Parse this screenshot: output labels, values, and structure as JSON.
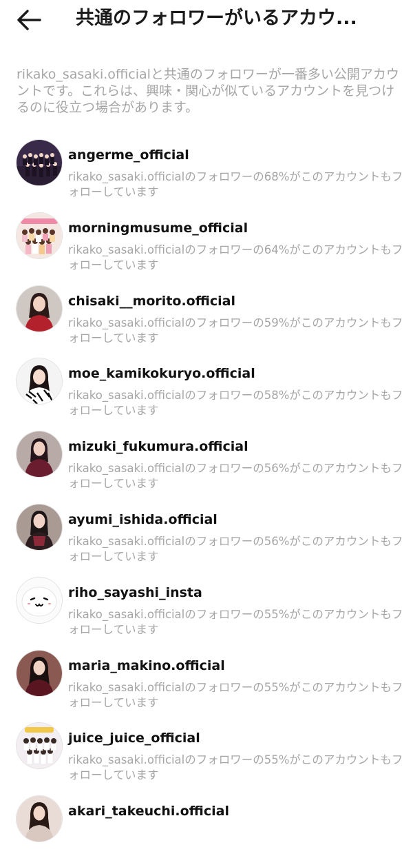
{
  "header": {
    "back_icon": "arrow-left-icon",
    "title": "共通のフォロワーがいるアカウ..."
  },
  "description": "rikako_sasaki.officialと共通のフォロワーが一番多い公開アカウントです。これらは、興味・関心が似ているアカウントを見つけるのに役立つ場合があります。",
  "accounts": [
    {
      "username": "angerme_official",
      "subtext": "rikako_sasaki.officialのフォロワーの68%がこのアカウントもフォローしています",
      "avatar": "group-photo"
    },
    {
      "username": "morningmusume_official",
      "subtext": "rikako_sasaki.officialのフォロワーの64%がこのアカウントもフォローしています",
      "avatar": "group-photo"
    },
    {
      "username": "chisaki__morito.official",
      "subtext": "rikako_sasaki.officialのフォロワーの59%がこのアカウントもフォローしています",
      "avatar": "portrait"
    },
    {
      "username": "moe_kamikokuryo.official",
      "subtext": "rikako_sasaki.officialのフォロワーの58%がこのアカウントもフォローしています",
      "avatar": "portrait"
    },
    {
      "username": "mizuki_fukumura.official",
      "subtext": "rikako_sasaki.officialのフォロワーの56%がこのアカウントもフォローしています",
      "avatar": "portrait"
    },
    {
      "username": "ayumi_ishida.official",
      "subtext": "rikako_sasaki.officialのフォロワーの56%がこのアカウントもフォローしています",
      "avatar": "portrait"
    },
    {
      "username": "riho_sayashi_insta",
      "subtext": "rikako_sasaki.officialのフォロワーの55%がこのアカウントもフォローしています",
      "avatar": "smiley-drawing"
    },
    {
      "username": "maria_makino.official",
      "subtext": "rikako_sasaki.officialのフォロワーの55%がこのアカウントもフォローしています",
      "avatar": "portrait"
    },
    {
      "username": "juice_juice_official",
      "subtext": "rikako_sasaki.officialのフォロワーの55%がこのアカウントもフォローしています",
      "avatar": "group-photo"
    },
    {
      "username": "akari_takeuchi.official",
      "subtext": "",
      "avatar": "portrait"
    }
  ],
  "colors": {
    "text_primary": "#111111",
    "text_secondary": "#a6a6a6",
    "background": "#ffffff"
  }
}
